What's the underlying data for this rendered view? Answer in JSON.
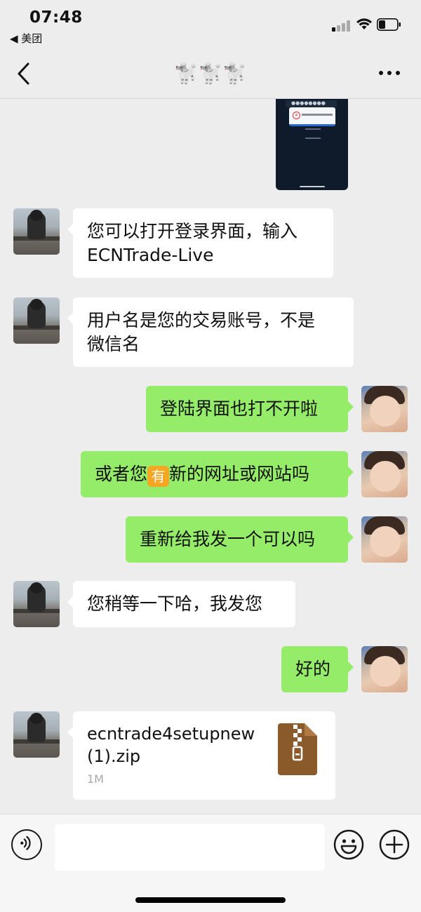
{
  "status_bar": {
    "time": "07:48",
    "back_app": "◀ 美团"
  },
  "nav": {
    "title": "🐩🐩🐩"
  },
  "messages": [
    {
      "from": "other",
      "text": "您可以打开登录界面，输入\nECNTrade-Live"
    },
    {
      "from": "other",
      "text": "用户名是您的交易账号，不是\n微信名"
    },
    {
      "from": "me",
      "text": "登陆界面也打不开啦"
    },
    {
      "from": "me",
      "text_before": "或者您",
      "badge": "有",
      "text_after": "新的网址或网站吗"
    },
    {
      "from": "me",
      "text": "重新给我发一个可以吗"
    },
    {
      "from": "other",
      "text": "您稍等一下哈，我发您"
    },
    {
      "from": "me",
      "text": "好的"
    }
  ],
  "file": {
    "name": "ecntrade4setupnew (1).zip",
    "size": "1M",
    "icon": "zip-file-icon"
  },
  "input": {
    "placeholder": ""
  },
  "colors": {
    "background": "#ededed",
    "bubble_in": "#ffffff",
    "bubble_out": "#95ec69",
    "zip_icon": "#8b5a2b"
  }
}
